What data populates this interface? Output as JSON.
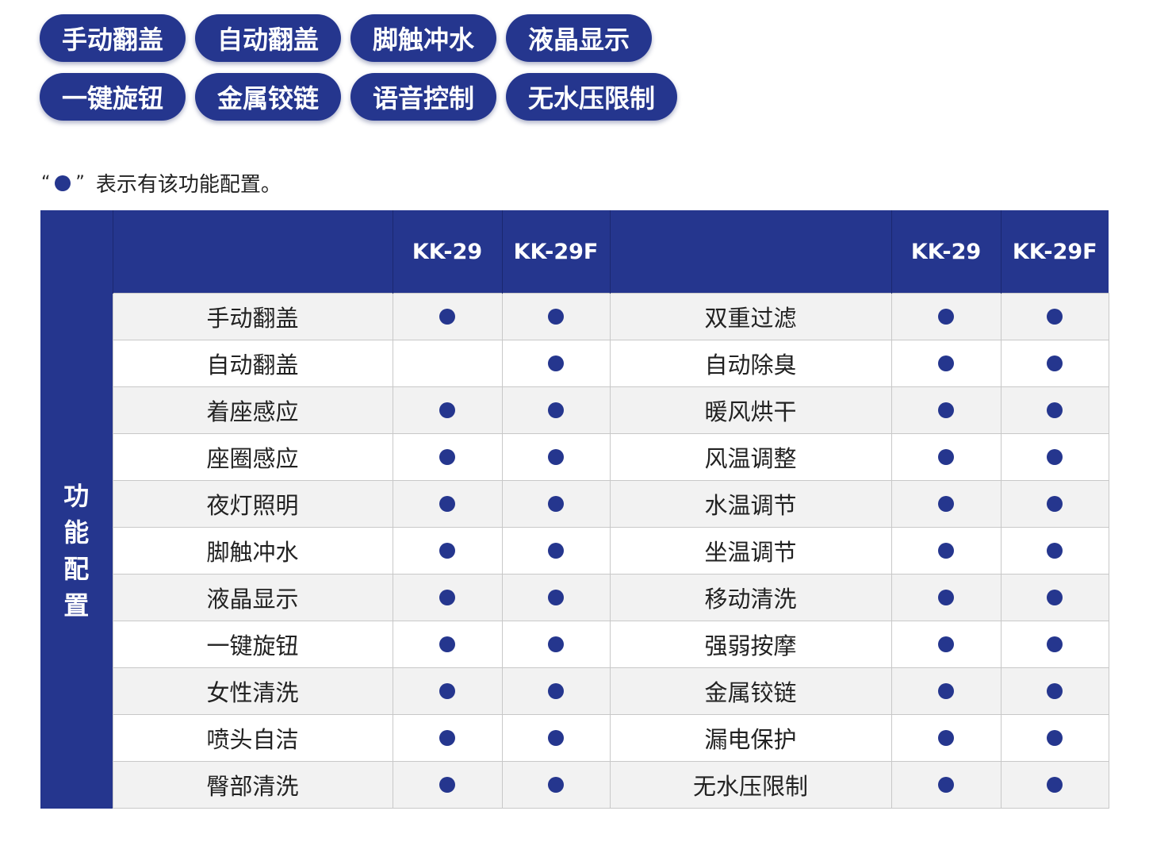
{
  "tags": {
    "row1": [
      "手动翻盖",
      "自动翻盖",
      "脚触冲水",
      "液晶显示"
    ],
    "row2": [
      "一键旋钮",
      "金属铰链",
      "语音控制",
      "无水压限制"
    ]
  },
  "legend": {
    "open_quote": "“",
    "close_quote": "”",
    "text": "表示有该功能配置。"
  },
  "table": {
    "header": [
      "",
      "",
      "KK-29",
      "KK-29F",
      "",
      "KK-29",
      "KK-29F"
    ],
    "side_label": [
      "功",
      "能",
      "配",
      "置"
    ],
    "rows": [
      {
        "left": "手动翻盖",
        "l29": true,
        "l29f": true,
        "right": "双重过滤",
        "r29": true,
        "r29f": true
      },
      {
        "left": "自动翻盖",
        "l29": false,
        "l29f": true,
        "right": "自动除臭",
        "r29": true,
        "r29f": true
      },
      {
        "left": "着座感应",
        "l29": true,
        "l29f": true,
        "right": "暖风烘干",
        "r29": true,
        "r29f": true
      },
      {
        "left": "座圈感应",
        "l29": true,
        "l29f": true,
        "right": "风温调整",
        "r29": true,
        "r29f": true
      },
      {
        "left": "夜灯照明",
        "l29": true,
        "l29f": true,
        "right": "水温调节",
        "r29": true,
        "r29f": true
      },
      {
        "left": "脚触冲水",
        "l29": true,
        "l29f": true,
        "right": "坐温调节",
        "r29": true,
        "r29f": true
      },
      {
        "left": "液晶显示",
        "l29": true,
        "l29f": true,
        "right": "移动清洗",
        "r29": true,
        "r29f": true
      },
      {
        "left": "一键旋钮",
        "l29": true,
        "l29f": true,
        "right": "强弱按摩",
        "r29": true,
        "r29f": true
      },
      {
        "left": "女性清洗",
        "l29": true,
        "l29f": true,
        "right": "金属铰链",
        "r29": true,
        "r29f": true
      },
      {
        "left": "喷头自洁",
        "l29": true,
        "l29f": true,
        "right": "漏电保护",
        "r29": true,
        "r29f": true
      },
      {
        "left": "臀部清洗",
        "l29": true,
        "l29f": true,
        "right": "无水压限制",
        "r29": true,
        "r29f": true
      }
    ]
  },
  "colors": {
    "brand_blue": "#25368e",
    "row_alt": "#f2f2f2"
  }
}
